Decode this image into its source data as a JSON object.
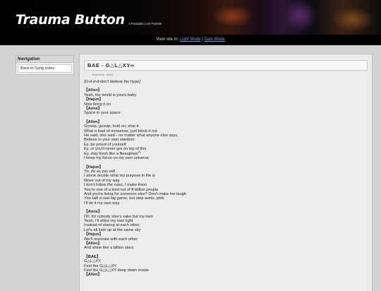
{
  "header": {
    "title": "Trauma Button",
    "subtitle": "A Paradise Live Fansite"
  },
  "modebar": {
    "prefix": "View site in:",
    "light": "Light Mode",
    "sep": " | ",
    "dark": "Dark Mode"
  },
  "nav": {
    "title": "Navigation",
    "items": [
      "Back to Song index"
    ]
  },
  "song": {
    "title": "BAE - G△L△XY∞",
    "romanize": "Romanize: Jakkie",
    "intro": "(D-d-d-d-don't believe the hype)"
  },
  "stanzas": [
    [
      {
        "t": "singer",
        "v": "【Allen】"
      },
      {
        "t": "line",
        "v": "Yeah, the world is yours baby"
      },
      {
        "t": "singer",
        "v": "【Hajun】"
      },
      {
        "t": "line",
        "v": "Now bring it on"
      },
      {
        "t": "singer",
        "v": "【Anne】"
      },
      {
        "t": "line",
        "v": "Space in your space"
      }
    ],
    [
      {
        "t": "singer",
        "v": "【Allen】"
      },
      {
        "t": "line",
        "v": "Gossip, gossip, hold on, stop it"
      },
      {
        "t": "line",
        "v": "What a load of nonsense, just block it out"
      },
      {
        "t": "line",
        "v": "He said, she said-- no matter what anyone else says,"
      },
      {
        "t": "line",
        "v": "Believe in your own stardom"
      },
      {
        "t": "line",
        "v": "Ey, be proud of yourself"
      },
      {
        "t": "line",
        "v": "Ey, or you'll never get on top of this"
      },
      {
        "t": "line",
        "v": "Ey, stay fresh like a Beaujolais",
        "sup": "[1]"
      },
      {
        "t": "line",
        "v": "I keep my focus on my own universe"
      }
    ],
    [
      {
        "t": "singer",
        "v": "【Hajun】"
      },
      {
        "t": "italic",
        "v": "Yo, do as you will"
      },
      {
        "t": "line",
        "v": "I alone decide what my purpose in life is"
      },
      {
        "t": "line",
        "v": "Move out of my way"
      },
      {
        "t": "line",
        "v": "I don't follow the rules, I make them"
      },
      {
        "t": "line",
        "v": "You're one of a kind out of 8 billion people"
      },
      {
        "t": "line",
        "v": "And you're living for someone else? Don't make me laugh"
      },
      {
        "t": "mixed",
        "it": "You talk a real big game,",
        "v": " but step aside, pleb"
      },
      {
        "t": "line",
        "v": "I'll do it my own way"
      }
    ],
    [
      {
        "t": "singer",
        "v": "【Anne】"
      },
      {
        "t": "line",
        "v": "Oh, for nobody else's sake but my own"
      },
      {
        "t": "line",
        "v": "Yeah, I'll shine my own light"
      },
      {
        "t": "line",
        "v": "Instead of staring at each other,"
      },
      {
        "t": "line",
        "v": "Let's all look up at the same sky"
      },
      {
        "t": "singer",
        "v": "【Hajun】"
      },
      {
        "t": "line",
        "v": "We'll resonate with each other"
      },
      {
        "t": "singer",
        "v": "【Allen】"
      },
      {
        "t": "line",
        "v": "And shine like a billion stars"
      }
    ],
    [
      {
        "t": "singer",
        "v": "【BAE】"
      },
      {
        "t": "line",
        "v": "G△L△XY"
      },
      {
        "t": "line",
        "v": "Feel the G△L△XY"
      },
      {
        "t": "line",
        "v": "Feel the G△L△XY deep down inside"
      },
      {
        "t": "singer",
        "v": "【Allen】"
      }
    ]
  ]
}
